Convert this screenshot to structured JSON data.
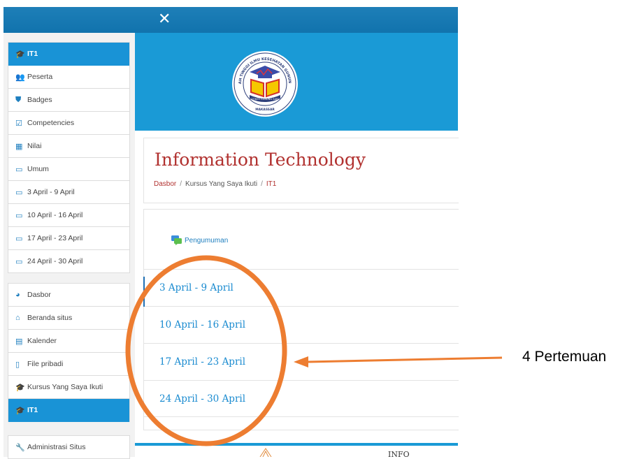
{
  "topbar": {
    "close_icon": "close-icon"
  },
  "sidebar": {
    "course_group": [
      {
        "label": "IT1",
        "icon": "graduation-cap-icon",
        "header": true
      },
      {
        "label": "Peserta",
        "icon": "users-icon"
      },
      {
        "label": "Badges",
        "icon": "shield-icon"
      },
      {
        "label": "Competencies",
        "icon": "checkbox-icon"
      },
      {
        "label": "Nilai",
        "icon": "table-icon"
      },
      {
        "label": "Umum",
        "icon": "folder-icon"
      },
      {
        "label": "3 April - 9 April",
        "icon": "folder-icon"
      },
      {
        "label": "10 April - 16 April",
        "icon": "folder-icon"
      },
      {
        "label": "17 April - 23 April",
        "icon": "folder-icon"
      },
      {
        "label": "24 April - 30 April",
        "icon": "folder-icon"
      }
    ],
    "site_group": [
      {
        "label": "Dasbor",
        "icon": "dashboard-icon"
      },
      {
        "label": "Beranda situs",
        "icon": "home-icon"
      },
      {
        "label": "Kalender",
        "icon": "calendar-icon"
      },
      {
        "label": "File pribadi",
        "icon": "file-icon"
      },
      {
        "label": "Kursus Yang Saya Ikuti",
        "icon": "graduation-cap-icon"
      },
      {
        "label": "IT1",
        "icon": "graduation-cap-icon",
        "header": true
      }
    ],
    "admin_group": [
      {
        "label": "Administrasi Situs",
        "icon": "wrench-icon"
      }
    ]
  },
  "banner": {
    "logo_ring_top": "SEKOLAH TINGGI ILMU KESEHATAN GUNUNG SARI",
    "logo_ribbon": "STIKES GUNUNG SARI",
    "logo_city": "MAKASSAR"
  },
  "course": {
    "title": "Information Technology",
    "breadcrumb": [
      "Dasbor",
      "Kursus Yang Saya Ikuti",
      "IT1"
    ]
  },
  "content": {
    "announcement": "Pengumuman",
    "sections": [
      "3 April - 9 April",
      "10 April - 16 April",
      "17 April - 23 April",
      "24 April - 30 April"
    ]
  },
  "footer": {
    "info": "INFO"
  },
  "annotation": {
    "label": "4 Pertemuan",
    "color": "#ed7d31"
  }
}
